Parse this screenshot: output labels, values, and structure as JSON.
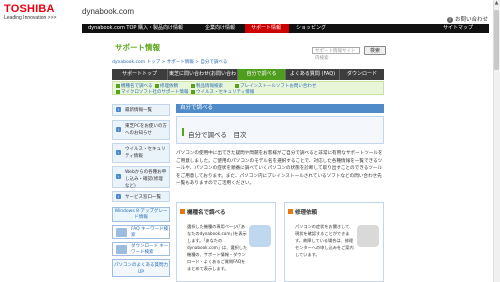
{
  "header": {
    "logo": "TOSHIBA",
    "tagline": "Leading Innovation >>>",
    "site": "dynabook.com",
    "contact": "お問い合わせ"
  },
  "global_nav": [
    {
      "label": "dynabook.com TOP 購入・製品向け情報"
    },
    {
      "label": "企業向け情報"
    },
    {
      "label": "サポート情報"
    },
    {
      "label": "ショッピング"
    },
    {
      "label": "サイトマップ"
    }
  ],
  "section": {
    "title": "サポート情報",
    "search_placeholder": "サポート情報サイト内検索",
    "search_button": "検索",
    "breadcrumb": "dynabook.com トップ > サポート情報 > 自分で調べる"
  },
  "tabs": [
    {
      "label": "サポートトップ"
    },
    {
      "label": "東芝に問い合わせ(お問い合わせ)"
    },
    {
      "label": "自分で調べる"
    },
    {
      "label": "よくある質問 (FAQ)"
    },
    {
      "label": "ダウンロード"
    }
  ],
  "sublinks": [
    {
      "label": "機種名で調べる"
    },
    {
      "label": "修理依頼"
    },
    {
      "label": "製品情報検索"
    },
    {
      "label": "プレインストールソフトお問い合わせ"
    },
    {
      "label": "マイクロソフト社のサポート情報"
    },
    {
      "label": "ウイルス・セキュリティ情報"
    }
  ],
  "sidebar": {
    "items": [
      {
        "label": "最新情報一覧"
      },
      {
        "label": "東芝PCをお使いの方へのお知らせ"
      },
      {
        "label": "ウイルス・セキュリティ情報"
      },
      {
        "label": "Webからの各種お申し込み・確認(修理など)"
      },
      {
        "label": "サービス窓口一覧"
      }
    ],
    "banners": [
      {
        "label": "Windows 8 アップグレード情報"
      },
      {
        "label": "FAQ キーワード検索"
      },
      {
        "label": "ダウンロード キーワード検索"
      },
      {
        "label": "パソコンのよくある質問力UP"
      }
    ]
  },
  "main": {
    "header": "自分で調べる",
    "toc_title": "自分で調べる　目次",
    "intro": "パソコンの使用中に出てきた疑問や問題をお客様がご自分で調べると非常に有用なサポートツールをご用意しました。ご使用のパソコンのモデル名を選択することで、対応した各種情報を一覧できるツールや、パソコンの症状を順番に調べていくパソコンの状態を診断して取り出すことのできるツールをご用意しております。また、パソコン内にプレインストールされているソフトなどの問い合わせ先一覧もありますのでご活用ください。",
    "cards": [
      {
        "title": "機種名で調べる",
        "text": "選択した機種の専用ページ(「あなたのdynabook.com」)を表示します。「あなたのdynabook.com」は、選択した機種の、サポート情報・ダウンロード・よくあるご質問FAQをまとめて表示します。"
      },
      {
        "title": "修理依頼",
        "text": "パソコンの症状をお聞きして、現状を確認することができます。故障している場合は、修理センターへの申し込みをご案内しています。"
      }
    ]
  },
  "colors": {
    "brand_red": "#e60012",
    "green": "#5aa319",
    "blue": "#4f8bc9"
  }
}
